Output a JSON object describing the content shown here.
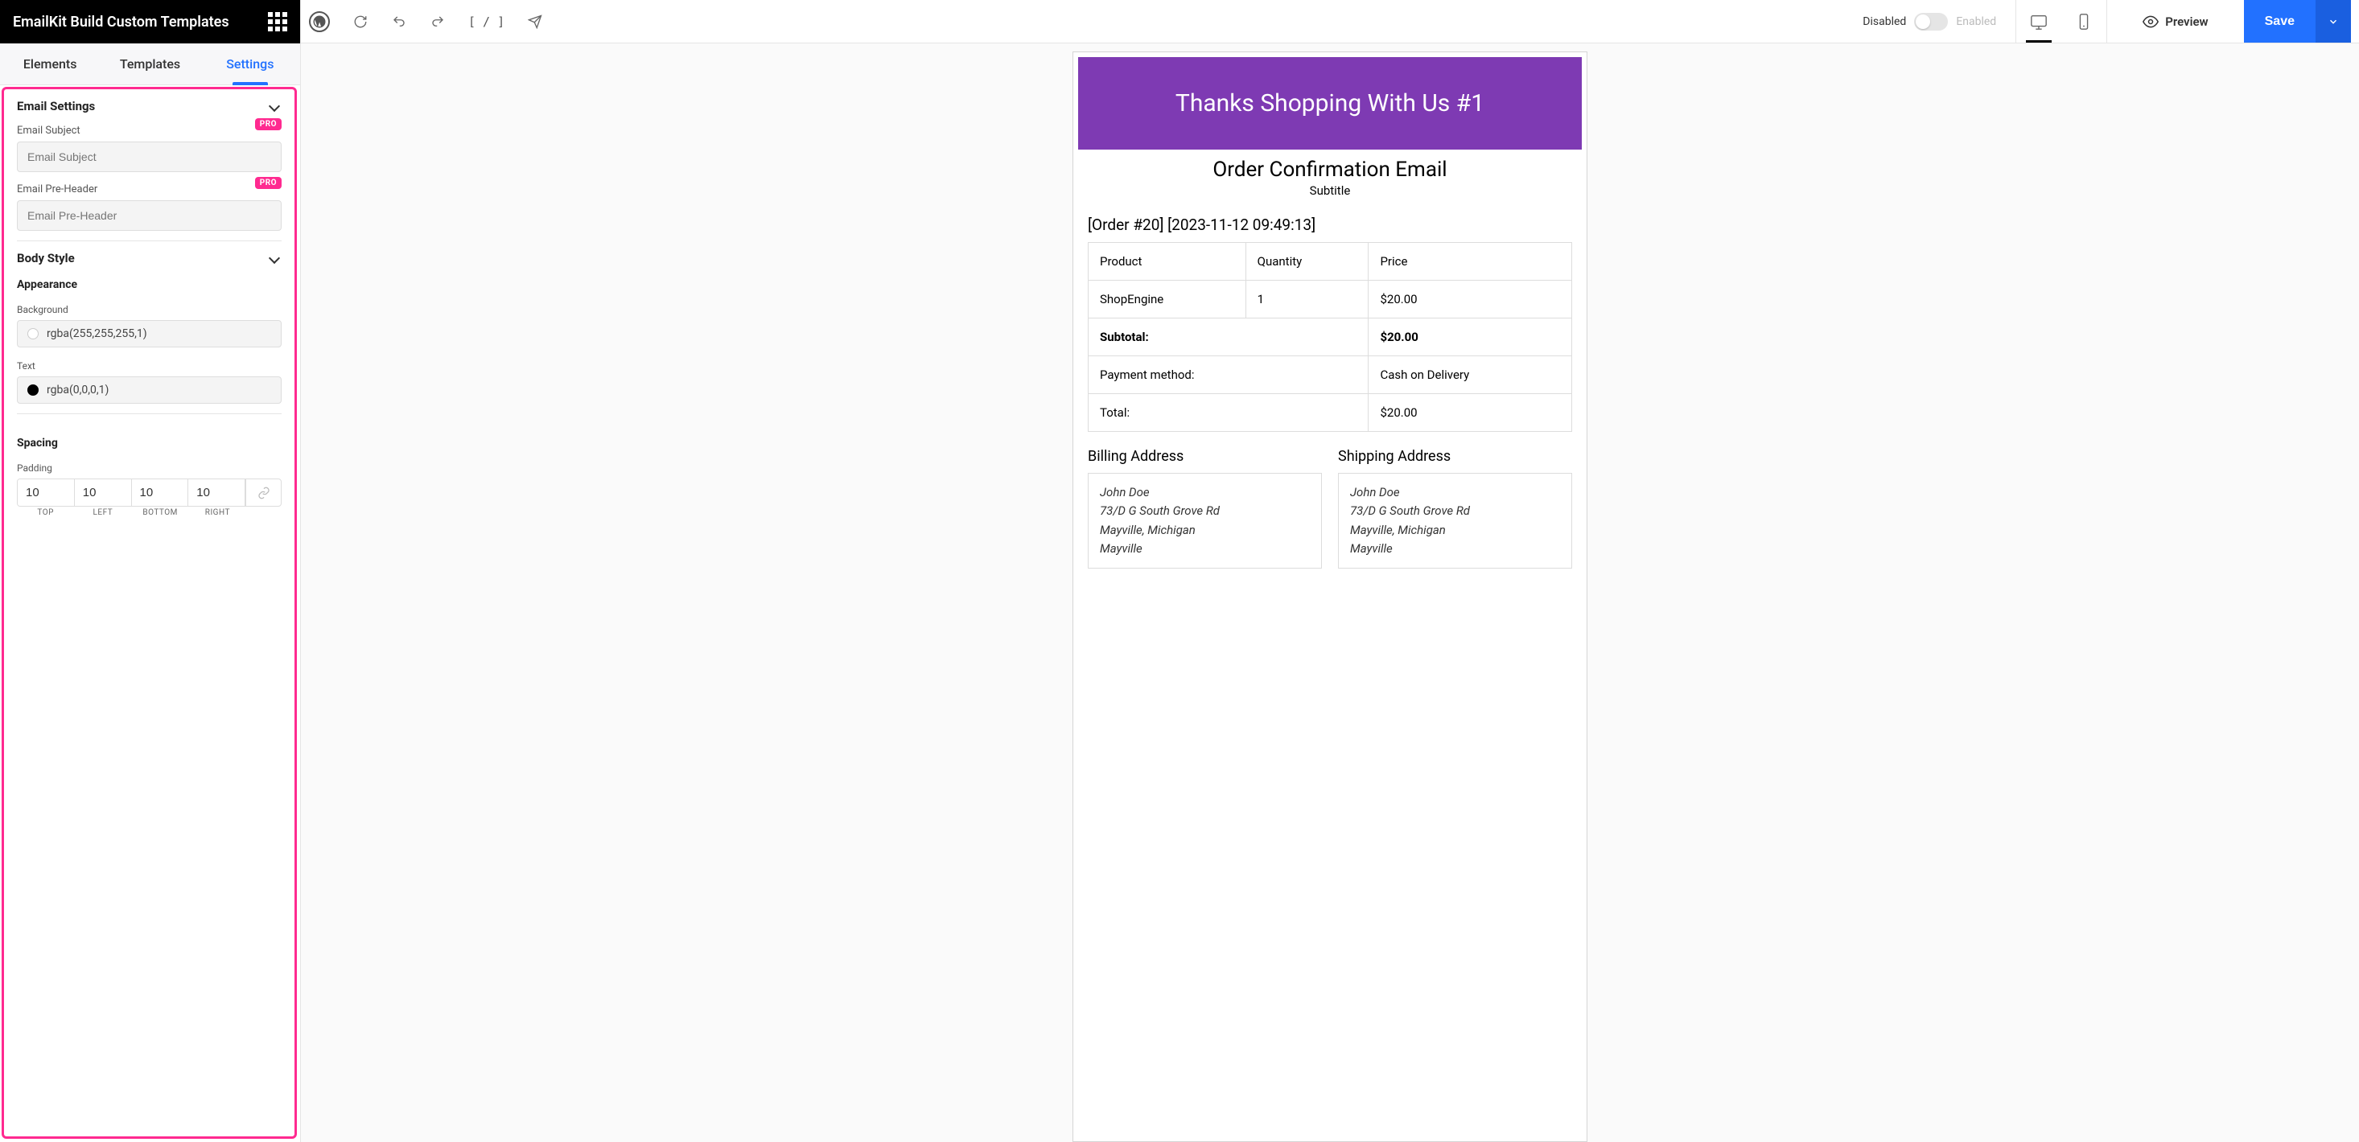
{
  "header": {
    "title": "EmailKit Build Custom Templates"
  },
  "sidebarTabs": {
    "elements": "Elements",
    "templates": "Templates",
    "settings": "Settings"
  },
  "sections": {
    "emailSettings": {
      "title": "Email Settings",
      "subjectLabel": "Email Subject",
      "subjectPlaceholder": "Email Subject",
      "preheaderLabel": "Email Pre-Header",
      "preheaderPlaceholder": "Email Pre-Header",
      "proBadge": "PRO"
    },
    "bodyStyle": {
      "title": "Body Style",
      "appearance": "Appearance",
      "backgroundLabel": "Background",
      "backgroundValue": "rgba(255,255,255,1)",
      "textLabel": "Text",
      "textValue": "rgba(0,0,0,1)",
      "spacing": "Spacing",
      "paddingLabel": "Padding",
      "padding": {
        "top": "10",
        "left": "10",
        "bottom": "10",
        "right": "10"
      },
      "padLabels": {
        "top": "TOP",
        "left": "LEFT",
        "bottom": "BOTTOM",
        "right": "RIGHT"
      }
    }
  },
  "topbar": {
    "disabled": "Disabled",
    "enabled": "Enabled",
    "preview": "Preview",
    "save": "Save",
    "shortcode": "[ / ]"
  },
  "email": {
    "hero": "Thanks Shopping With Us #1",
    "title": "Order Confirmation Email",
    "subtitle": "Subtitle",
    "orderMeta": "[Order #20] [2023-11-12 09:49:13]",
    "tableHead": {
      "product": "Product",
      "qty": "Quantity",
      "price": "Price"
    },
    "items": [
      {
        "product": "ShopEngine",
        "qty": "1",
        "price": "$20.00"
      }
    ],
    "subtotalLabel": "Subtotal:",
    "subtotalValue": "$20.00",
    "paymentLabel": "Payment method:",
    "paymentValue": "Cash on Delivery",
    "totalLabel": "Total:",
    "totalValue": "$20.00",
    "billingTitle": "Billing Address",
    "shippingTitle": "Shipping Address",
    "addr": {
      "name": "John Doe",
      "street": "73/D G South Grove Rd",
      "cityState": "Mayville, Michigan",
      "city": "Mayville"
    }
  }
}
